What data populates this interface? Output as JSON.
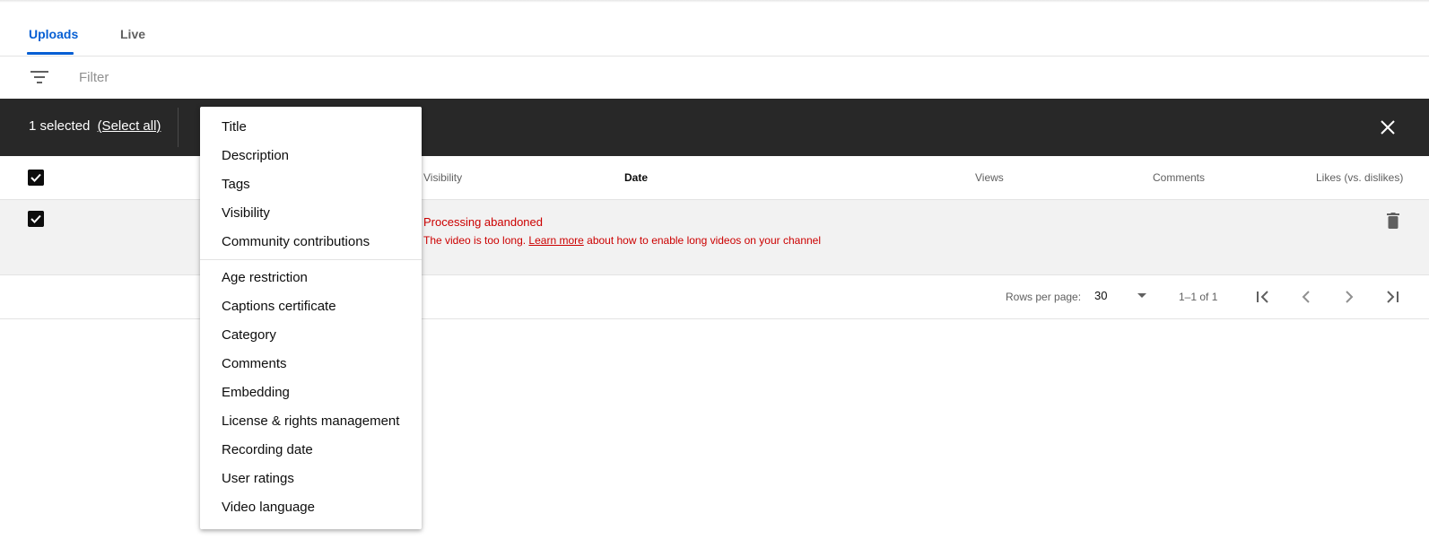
{
  "tabs": [
    {
      "label": "Uploads",
      "active": true
    },
    {
      "label": "Live",
      "active": false
    }
  ],
  "filter": {
    "placeholder": "Filter",
    "icon": "filter-icon"
  },
  "selection": {
    "count_text": "1 selected",
    "select_all": "(Select all)",
    "close_icon": "close-icon"
  },
  "table": {
    "columns": {
      "visibility": "Visibility",
      "date": "Date",
      "views": "Views",
      "comments": "Comments",
      "likes": "Likes (vs. dislikes)"
    },
    "row": {
      "checked": true,
      "error_title": "Processing abandoned",
      "error_prefix": "The video is too long.",
      "error_link": "Learn more",
      "error_suffix": "about how to enable long videos on your channel",
      "action_icon": "trash-icon"
    }
  },
  "pagination": {
    "rows_per_page_label": "Rows per page:",
    "rows_per_page": "30",
    "range": "1–1 of 1"
  },
  "menu": {
    "group1": [
      "Title",
      "Description",
      "Tags",
      "Visibility",
      "Community contributions"
    ],
    "group2": [
      "Age restriction",
      "Captions certificate",
      "Category",
      "Comments",
      "Embedding",
      "License & rights management",
      "Recording date",
      "User ratings",
      "Video language"
    ]
  },
  "colors": {
    "accent": "#065fd4",
    "selection_bar": "#282828",
    "error": "#cc0000",
    "row_selected_bg": "#f2f2f2"
  }
}
